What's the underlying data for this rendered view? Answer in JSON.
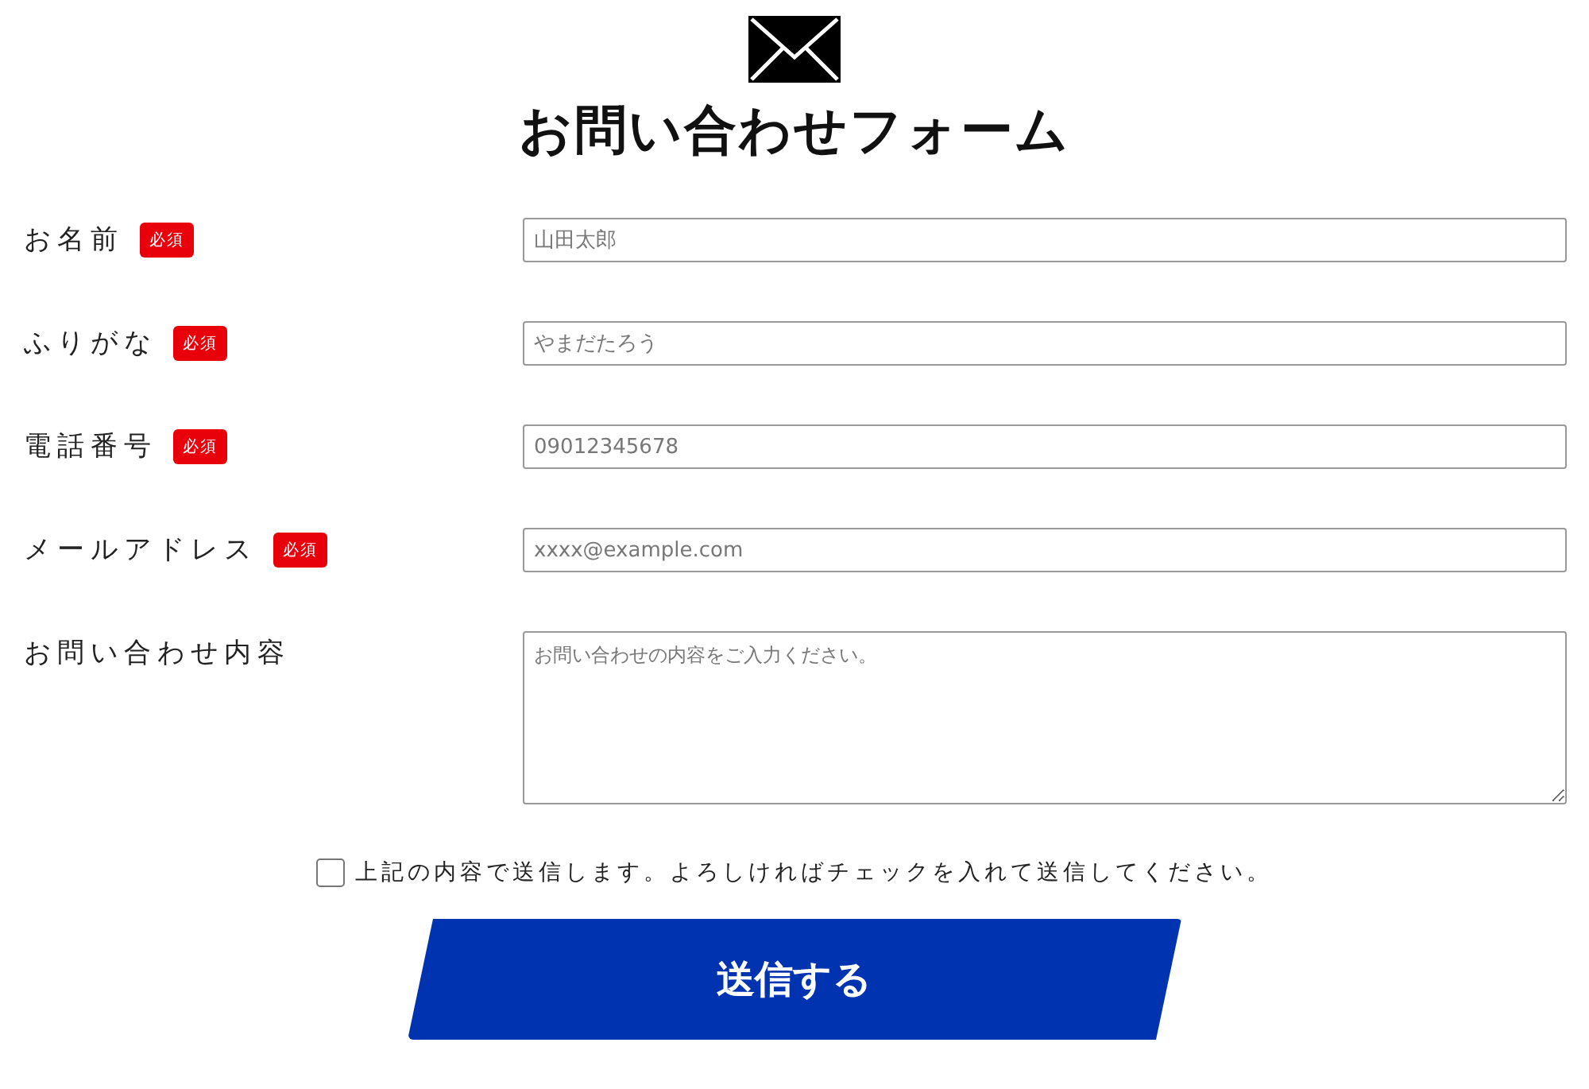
{
  "title": "お問い合わせフォーム",
  "fields": [
    {
      "label": "お名前",
      "required": true,
      "required_badge": "必須",
      "kind": "input",
      "placeholder": "山田太郎"
    },
    {
      "label": "ふりがな",
      "required": true,
      "required_badge": "必須",
      "kind": "input",
      "placeholder": "やまだたろう"
    },
    {
      "label": "電話番号",
      "required": true,
      "required_badge": "必須",
      "kind": "input",
      "placeholder": "09012345678"
    },
    {
      "label": "メールアドレス",
      "required": true,
      "required_badge": "必須",
      "kind": "input",
      "placeholder": "xxxx@example.com"
    },
    {
      "label": "お問い合わせ内容",
      "required": false,
      "kind": "textarea",
      "placeholder": "お問い合わせの内容をご入力ください。"
    }
  ],
  "consent": {
    "label": "上記の内容で送信します。よろしければチェックを入れて送信してください。",
    "checked": false
  },
  "submit_button": "送信する"
}
